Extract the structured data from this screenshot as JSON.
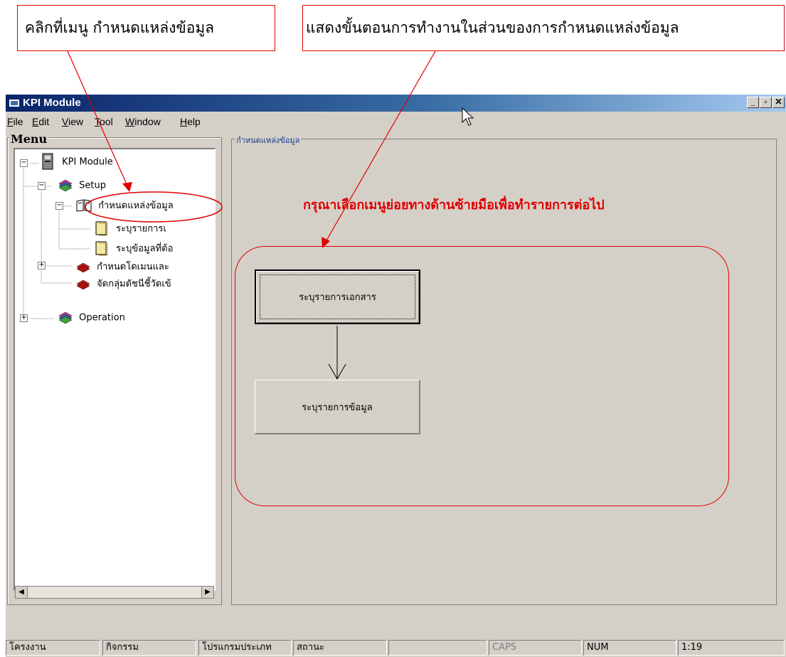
{
  "callouts": {
    "left": "คลิกที่เมนู กำหนดแหล่งข้อมูล",
    "right": "แสดงขั้นตอนการทำงานในส่วนของการกำหนดแหล่งข้อมูล"
  },
  "window": {
    "title": "KPI Module",
    "buttons": {
      "minimize": "_",
      "restore": "▫",
      "close": "✕"
    }
  },
  "menubar": [
    "File",
    "Edit",
    "View",
    "Tool",
    "Window",
    "Help"
  ],
  "menu": {
    "legend": "Menu",
    "tree": {
      "root": "KPI Module",
      "setup": "Setup",
      "data_source": "กำหนดแหล่งข้อมูล",
      "doc_list": "ระบุรายการเ",
      "data_needed": "ระบุข้อมูลที่ต้อ",
      "domain": "กำหนดโดเมนและ",
      "group": "จัดกลุ่มดัชนีชี้วัดเข้",
      "operation": "Operation"
    }
  },
  "content": {
    "legend": "กำหนดแหล่งข้อมูล",
    "instruction": "กรุณาเลือกเมนูย่อยทางด้านซ้ายมือเพื่อทำรายการต่อไป",
    "steps": [
      "ระบุรายการเอกสาร",
      "ระบุรายการข้อมูล"
    ]
  },
  "statusbar": [
    "โครงงาน",
    "กิจกรรม",
    "โปรแกรมประเภท",
    "สถานะ",
    "",
    "CAPS",
    "NUM",
    "1:19"
  ],
  "colors": {
    "annotation": "#e00000",
    "titlebar": "#0a246a",
    "window": "#d4d0c8"
  }
}
